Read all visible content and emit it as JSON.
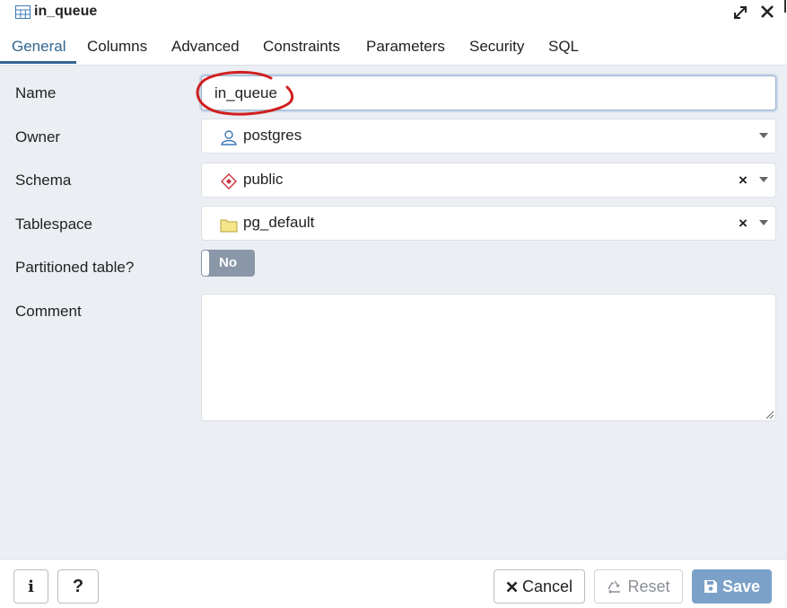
{
  "window": {
    "title": "in_queue",
    "icons": {
      "table": "table-icon",
      "expand": "expand-icon",
      "close": "close-icon"
    }
  },
  "tabs": [
    {
      "label": "General",
      "active": true
    },
    {
      "label": "Columns"
    },
    {
      "label": "Advanced"
    },
    {
      "label": "Constraints"
    },
    {
      "label": "Parameters"
    },
    {
      "label": "Security"
    },
    {
      "label": "SQL"
    }
  ],
  "form": {
    "name": {
      "label": "Name",
      "value": "in_queue"
    },
    "owner": {
      "label": "Owner",
      "value": "postgres",
      "icon": "user-icon"
    },
    "schema": {
      "label": "Schema",
      "value": "public",
      "icon": "schema-diamond-icon",
      "clear": "×"
    },
    "tablespace": {
      "label": "Tablespace",
      "value": "pg_default",
      "icon": "folder-icon",
      "clear": "×"
    },
    "partitioned": {
      "label": "Partitioned table?",
      "state": "No"
    },
    "comment": {
      "label": "Comment",
      "value": ""
    }
  },
  "footer": {
    "info": "i",
    "help": "?",
    "cancel": "Cancel",
    "reset": "Reset",
    "save": "Save"
  },
  "colors": {
    "accent": "#326690",
    "panel": "#ebeef3",
    "annotation": "#d0201f",
    "save": "#7ba1c8",
    "toggle_off": "#8a97a8"
  }
}
